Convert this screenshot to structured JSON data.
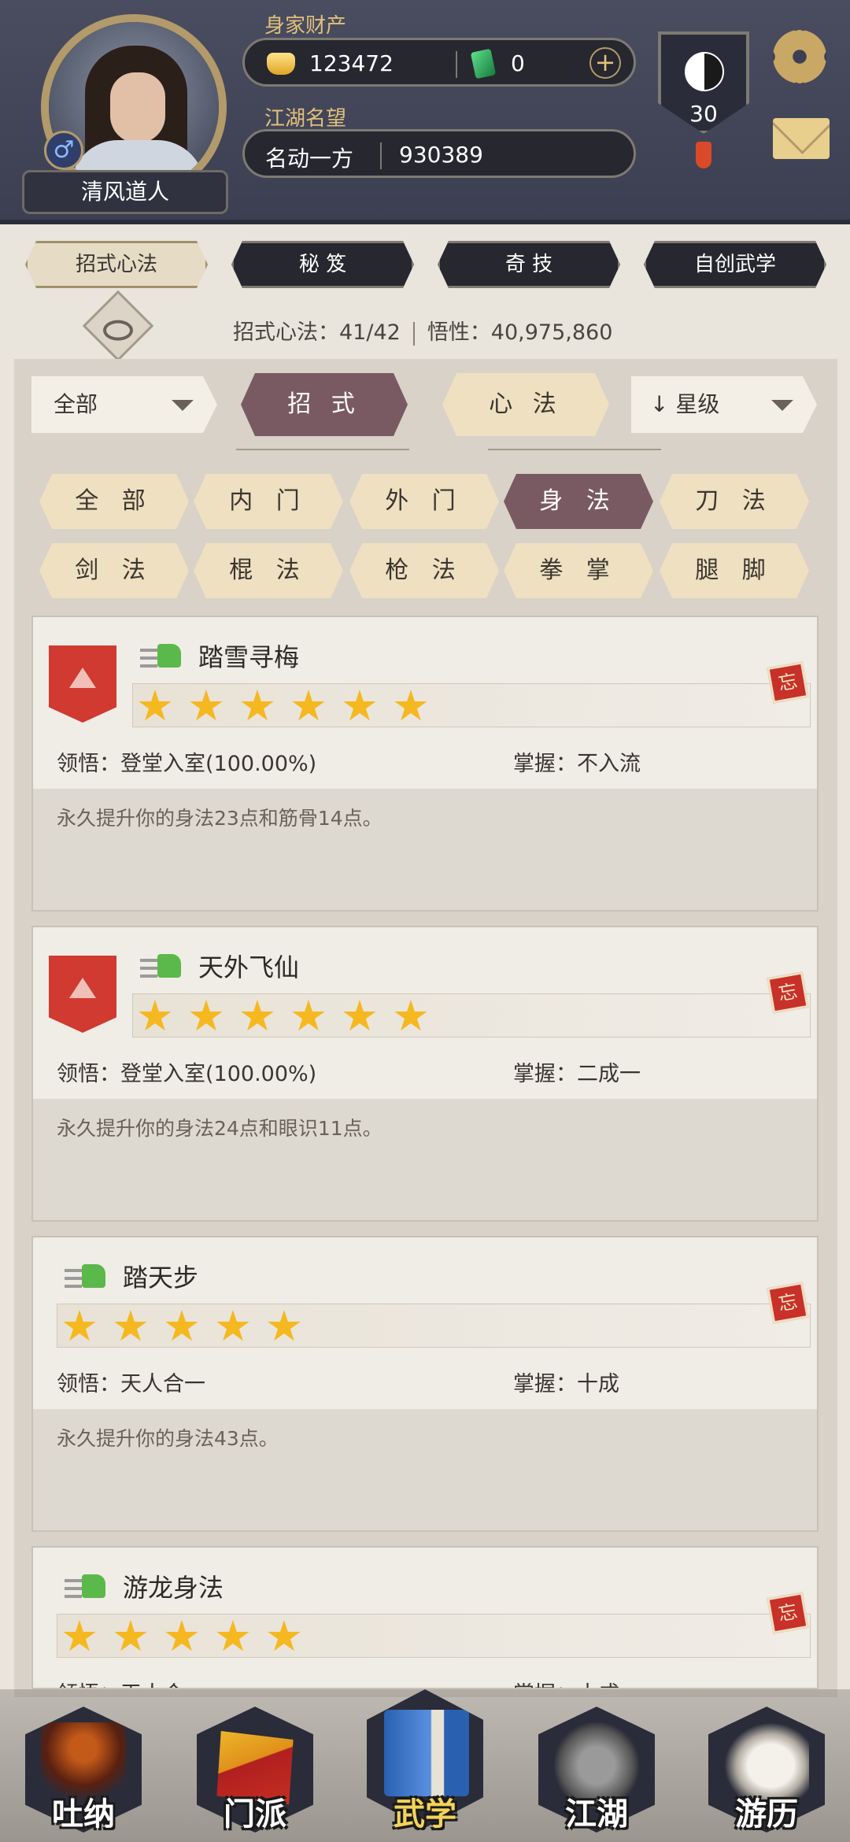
{
  "header": {
    "player_name": "清风道人",
    "gender_symbol": "♂",
    "wealth_label": "身家财产",
    "gold_amount": "123472",
    "jade_amount": "0",
    "add_symbol": "+",
    "reputation_label": "江湖名望",
    "reputation_title": "名动一方",
    "reputation_value": "930389",
    "level": "30"
  },
  "top_tabs": [
    {
      "label": "招式心法",
      "active": true
    },
    {
      "label": "秘 笈",
      "active": false
    },
    {
      "label": "奇 技",
      "active": false
    },
    {
      "label": "自创武学",
      "active": false
    }
  ],
  "stats": {
    "moves_label": "招式心法：41/42",
    "insight_label": "悟性：40,975,860"
  },
  "filters": {
    "scope_select": "全部",
    "sort_select": "星级",
    "sort_arrow": "↓",
    "mode_moves": "招 式",
    "mode_mind": "心 法",
    "categories": [
      "全 部",
      "内 门",
      "外 门",
      "身 法",
      "刀 法",
      "剑 法",
      "棍 法",
      "枪 法",
      "拳 掌",
      "腿 脚"
    ],
    "active_category": "身 法"
  },
  "skills": [
    {
      "name": "踏雪寻梅",
      "stars": 6,
      "upgradable": true,
      "comprehension": "领悟：登堂入室(100.00%)",
      "mastery": "掌握：不入流",
      "description": "永久提升你的身法23点和筋骨14点。"
    },
    {
      "name": "天外飞仙",
      "stars": 6,
      "upgradable": true,
      "comprehension": "领悟：登堂入室(100.00%)",
      "mastery": "掌握：二成一",
      "description": "永久提升你的身法24点和眼识11点。"
    },
    {
      "name": "踏天步",
      "stars": 5,
      "upgradable": false,
      "comprehension": "领悟：天人合一",
      "mastery": "掌握：十成",
      "description": "永久提升你的身法43点。"
    },
    {
      "name": "游龙身法",
      "stars": 5,
      "upgradable": false,
      "comprehension": "领悟：天人合一",
      "mastery": "掌握：十成",
      "description": ""
    }
  ],
  "forget_glyph": "忘",
  "star_glyph": "★",
  "bottom_nav": [
    {
      "label": "吐纳",
      "icon": "monk-meditation-icon",
      "active": false
    },
    {
      "label": "门派",
      "icon": "sect-banner-icon",
      "active": false
    },
    {
      "label": "武学",
      "icon": "martial-book-icon",
      "active": true
    },
    {
      "label": "江湖",
      "icon": "bamboo-hat-icon",
      "active": false
    },
    {
      "label": "游历",
      "icon": "white-horse-icon",
      "active": false
    }
  ],
  "colors": {
    "accent_active": "#7a5a62",
    "gold_text": "#e2c07a",
    "star": "#f5b820",
    "nav_active": "#f3d35a"
  }
}
